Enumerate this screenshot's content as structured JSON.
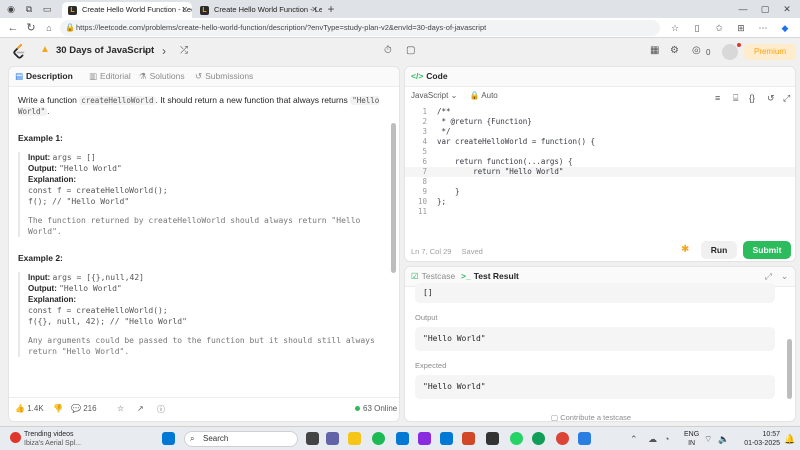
{
  "browser": {
    "tabs": [
      {
        "title": "Create Hello World Function - Lee",
        "active": true
      },
      {
        "title": "Create Hello World Function - Lee",
        "active": false
      }
    ],
    "url": "https://leetcode.com/problems/create-hello-world-function/description/?envType=study-plan-v2&envId=30-days-of-javascript"
  },
  "nav": {
    "study_plan_title": "30 Days of JavaScript",
    "streak_count": "0",
    "premium_label": "Premium"
  },
  "left_tabs": [
    {
      "label": "Description",
      "icon": "description-icon",
      "active": true
    },
    {
      "label": "Editorial",
      "icon": "editorial-icon",
      "active": false
    },
    {
      "label": "Solutions",
      "icon": "solutions-icon",
      "active": false
    },
    {
      "label": "Submissions",
      "icon": "submissions-icon",
      "active": false
    }
  ],
  "description": {
    "intro_before": "Write a function ",
    "intro_code": "createHelloWorld",
    "intro_after": ". It should return a new function that always returns ",
    "intro_code2": "\"Hello World\"",
    "intro_end": ".",
    "example1": {
      "title": "Example 1:",
      "input_label": "Input:",
      "input_value": "args = []",
      "output_label": "Output:",
      "output_value": "\"Hello World\"",
      "explanation_label": "Explanation:",
      "code1": "const f = createHelloWorld();",
      "code2": "f(); // \"Hello World\"",
      "note": "The function returned by createHelloWorld should always return \"Hello World\"."
    },
    "example2": {
      "title": "Example 2:",
      "input_label": "Input:",
      "input_value": "args = [{},null,42]",
      "output_label": "Output:",
      "output_value": "\"Hello World\"",
      "explanation_label": "Explanation:",
      "code1": "const f = createHelloWorld();",
      "code2": "f({}, null, 42); // \"Hello World\"",
      "note": "Any arguments could be passed to the function but it should still always return \"Hello World\"."
    }
  },
  "left_footer": {
    "likes": "1.4K",
    "comments": "216",
    "online": "63 Online"
  },
  "code_panel": {
    "title": "Code",
    "language": "JavaScript",
    "auto_label": "Auto",
    "lines": [
      {
        "n": "1",
        "text": "/**"
      },
      {
        "n": "2",
        "text": " * @return {Function}"
      },
      {
        "n": "3",
        "text": " */"
      },
      {
        "n": "4",
        "text": "var createHelloWorld = function() {"
      },
      {
        "n": "5",
        "text": ""
      },
      {
        "n": "6",
        "text": "    return function(...args) {"
      },
      {
        "n": "7",
        "text": "        return \"Hello World\""
      },
      {
        "n": "8",
        "text": ""
      },
      {
        "n": "9",
        "text": "    }"
      },
      {
        "n": "10",
        "text": "};"
      },
      {
        "n": "11",
        "text": ""
      }
    ],
    "status": "Ln 7, Col 29",
    "saved": "Saved",
    "run_label": "Run",
    "submit_label": "Submit"
  },
  "test_panel": {
    "testcase_tab": "Testcase",
    "result_tab": "Test Result",
    "input_value": "[]",
    "output_label": "Output",
    "output_value": "\"Hello World\"",
    "expected_label": "Expected",
    "expected_value": "\"Hello World\"",
    "contribute": "Contribute a testcase"
  },
  "taskbar": {
    "weather_title": "Trending videos",
    "weather_sub": "Ibiza's Aerial Spl...",
    "search_placeholder": "Search",
    "lang": "ENG",
    "region": "IN",
    "time": "10:57",
    "date": "01-03-2025"
  }
}
